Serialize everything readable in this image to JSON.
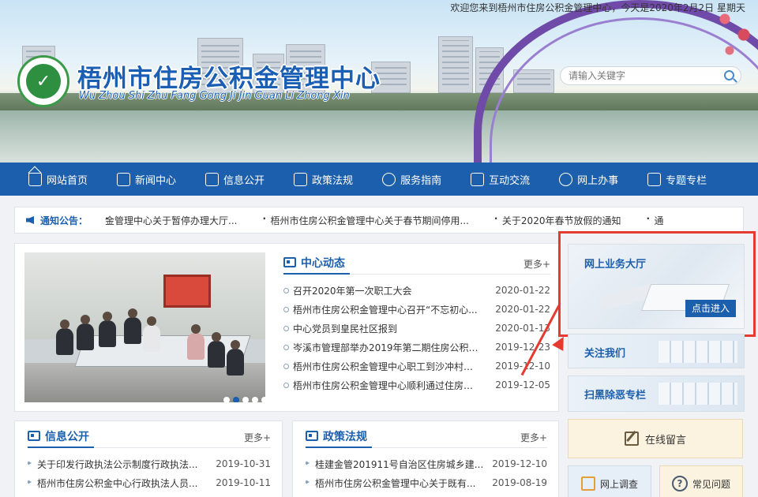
{
  "header": {
    "welcome": "欢迎您来到梧州市住房公积金管理中心，今天是2020年2月2日   星期天",
    "title": "梧州市住房公积金管理中心",
    "subtitle": "Wu Zhou Shi Zhu Fang Gong Ji Jin Guan Li Zhong Xin",
    "search_placeholder": "请输入关键字"
  },
  "nav": [
    {
      "label": "网站首页",
      "icon": "home-icon"
    },
    {
      "label": "新闻中心",
      "icon": "newspaper-icon"
    },
    {
      "label": "信息公开",
      "icon": "document-icon"
    },
    {
      "label": "政策法规",
      "icon": "book-icon"
    },
    {
      "label": "服务指南",
      "icon": "service-icon"
    },
    {
      "label": "互动交流",
      "icon": "chat-icon"
    },
    {
      "label": "网上办事",
      "icon": "shield-icon"
    },
    {
      "label": "专题专栏",
      "icon": "topic-icon"
    }
  ],
  "notice": {
    "label": "通知公告：",
    "items": [
      "金管理中心关于暂停办理大厅...",
      "梧州市住房公积金管理中心关于春节期间停用...",
      "关于2020年春节放假的通知",
      "通"
    ]
  },
  "news": {
    "title": "中心动态",
    "more": "更多+",
    "items": [
      {
        "text": "召开2020年第一次职工大会",
        "date": "2020-01-22"
      },
      {
        "text": "梧州市住房公积金管理中心召开“不忘初心...",
        "date": "2020-01-22"
      },
      {
        "text": "中心党员到皇民社区报到",
        "date": "2020-01-13"
      },
      {
        "text": "岑溪市管理部举办2019年第二期住房公积金...",
        "date": "2019-12-23"
      },
      {
        "text": "梧州市住房公积金管理中心职工到沙冲村开...",
        "date": "2019-12-10"
      },
      {
        "text": "梧州市住房公积金管理中心顺利通过住房公...",
        "date": "2019-12-05"
      }
    ]
  },
  "info": {
    "title": "信息公开",
    "more": "更多+",
    "items": [
      {
        "text": "关于印发行政执法公示制度行政执法...",
        "date": "2019-10-31"
      },
      {
        "text": "梧州市住房公积金中心行政执法人员...",
        "date": "2019-10-11"
      }
    ]
  },
  "policy": {
    "title": "政策法规",
    "more": "更多+",
    "items": [
      {
        "text": "桂建金管201911号自治区住房城乡建...",
        "date": "2019-12-10"
      },
      {
        "text": "梧州市住房公积金管理中心关于既有...",
        "date": "2019-08-19"
      }
    ]
  },
  "sidebar": {
    "online_hall": {
      "title": "网上业务大厅",
      "button": "点击进入"
    },
    "follow_us": "关注我们",
    "anti_crime": "扫黑除恶专栏",
    "message": "在线留言",
    "survey": "网上调查",
    "faq": "常见问题"
  },
  "colors": {
    "primary": "#1c5fac",
    "highlight": "#e53a2f"
  }
}
